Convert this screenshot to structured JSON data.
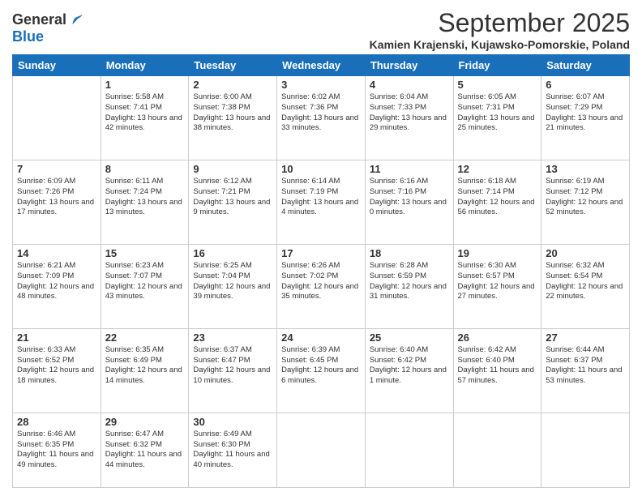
{
  "header": {
    "logo_general": "General",
    "logo_blue": "Blue",
    "month_title": "September 2025",
    "location": "Kamien Krajenski, Kujawsko-Pomorskie, Poland"
  },
  "days_of_week": [
    "Sunday",
    "Monday",
    "Tuesday",
    "Wednesday",
    "Thursday",
    "Friday",
    "Saturday"
  ],
  "weeks": [
    [
      {
        "day": "",
        "info": ""
      },
      {
        "day": "1",
        "info": "Sunrise: 5:58 AM\nSunset: 7:41 PM\nDaylight: 13 hours\nand 42 minutes."
      },
      {
        "day": "2",
        "info": "Sunrise: 6:00 AM\nSunset: 7:38 PM\nDaylight: 13 hours\nand 38 minutes."
      },
      {
        "day": "3",
        "info": "Sunrise: 6:02 AM\nSunset: 7:36 PM\nDaylight: 13 hours\nand 33 minutes."
      },
      {
        "day": "4",
        "info": "Sunrise: 6:04 AM\nSunset: 7:33 PM\nDaylight: 13 hours\nand 29 minutes."
      },
      {
        "day": "5",
        "info": "Sunrise: 6:05 AM\nSunset: 7:31 PM\nDaylight: 13 hours\nand 25 minutes."
      },
      {
        "day": "6",
        "info": "Sunrise: 6:07 AM\nSunset: 7:29 PM\nDaylight: 13 hours\nand 21 minutes."
      }
    ],
    [
      {
        "day": "7",
        "info": "Sunrise: 6:09 AM\nSunset: 7:26 PM\nDaylight: 13 hours\nand 17 minutes."
      },
      {
        "day": "8",
        "info": "Sunrise: 6:11 AM\nSunset: 7:24 PM\nDaylight: 13 hours\nand 13 minutes."
      },
      {
        "day": "9",
        "info": "Sunrise: 6:12 AM\nSunset: 7:21 PM\nDaylight: 13 hours\nand 9 minutes."
      },
      {
        "day": "10",
        "info": "Sunrise: 6:14 AM\nSunset: 7:19 PM\nDaylight: 13 hours\nand 4 minutes."
      },
      {
        "day": "11",
        "info": "Sunrise: 6:16 AM\nSunset: 7:16 PM\nDaylight: 13 hours\nand 0 minutes."
      },
      {
        "day": "12",
        "info": "Sunrise: 6:18 AM\nSunset: 7:14 PM\nDaylight: 12 hours\nand 56 minutes."
      },
      {
        "day": "13",
        "info": "Sunrise: 6:19 AM\nSunset: 7:12 PM\nDaylight: 12 hours\nand 52 minutes."
      }
    ],
    [
      {
        "day": "14",
        "info": "Sunrise: 6:21 AM\nSunset: 7:09 PM\nDaylight: 12 hours\nand 48 minutes."
      },
      {
        "day": "15",
        "info": "Sunrise: 6:23 AM\nSunset: 7:07 PM\nDaylight: 12 hours\nand 43 minutes."
      },
      {
        "day": "16",
        "info": "Sunrise: 6:25 AM\nSunset: 7:04 PM\nDaylight: 12 hours\nand 39 minutes."
      },
      {
        "day": "17",
        "info": "Sunrise: 6:26 AM\nSunset: 7:02 PM\nDaylight: 12 hours\nand 35 minutes."
      },
      {
        "day": "18",
        "info": "Sunrise: 6:28 AM\nSunset: 6:59 PM\nDaylight: 12 hours\nand 31 minutes."
      },
      {
        "day": "19",
        "info": "Sunrise: 6:30 AM\nSunset: 6:57 PM\nDaylight: 12 hours\nand 27 minutes."
      },
      {
        "day": "20",
        "info": "Sunrise: 6:32 AM\nSunset: 6:54 PM\nDaylight: 12 hours\nand 22 minutes."
      }
    ],
    [
      {
        "day": "21",
        "info": "Sunrise: 6:33 AM\nSunset: 6:52 PM\nDaylight: 12 hours\nand 18 minutes."
      },
      {
        "day": "22",
        "info": "Sunrise: 6:35 AM\nSunset: 6:49 PM\nDaylight: 12 hours\nand 14 minutes."
      },
      {
        "day": "23",
        "info": "Sunrise: 6:37 AM\nSunset: 6:47 PM\nDaylight: 12 hours\nand 10 minutes."
      },
      {
        "day": "24",
        "info": "Sunrise: 6:39 AM\nSunset: 6:45 PM\nDaylight: 12 hours\nand 6 minutes."
      },
      {
        "day": "25",
        "info": "Sunrise: 6:40 AM\nSunset: 6:42 PM\nDaylight: 12 hours\nand 1 minute."
      },
      {
        "day": "26",
        "info": "Sunrise: 6:42 AM\nSunset: 6:40 PM\nDaylight: 11 hours\nand 57 minutes."
      },
      {
        "day": "27",
        "info": "Sunrise: 6:44 AM\nSunset: 6:37 PM\nDaylight: 11 hours\nand 53 minutes."
      }
    ],
    [
      {
        "day": "28",
        "info": "Sunrise: 6:46 AM\nSunset: 6:35 PM\nDaylight: 11 hours\nand 49 minutes."
      },
      {
        "day": "29",
        "info": "Sunrise: 6:47 AM\nSunset: 6:32 PM\nDaylight: 11 hours\nand 44 minutes."
      },
      {
        "day": "30",
        "info": "Sunrise: 6:49 AM\nSunset: 6:30 PM\nDaylight: 11 hours\nand 40 minutes."
      },
      {
        "day": "",
        "info": ""
      },
      {
        "day": "",
        "info": ""
      },
      {
        "day": "",
        "info": ""
      },
      {
        "day": "",
        "info": ""
      }
    ]
  ]
}
